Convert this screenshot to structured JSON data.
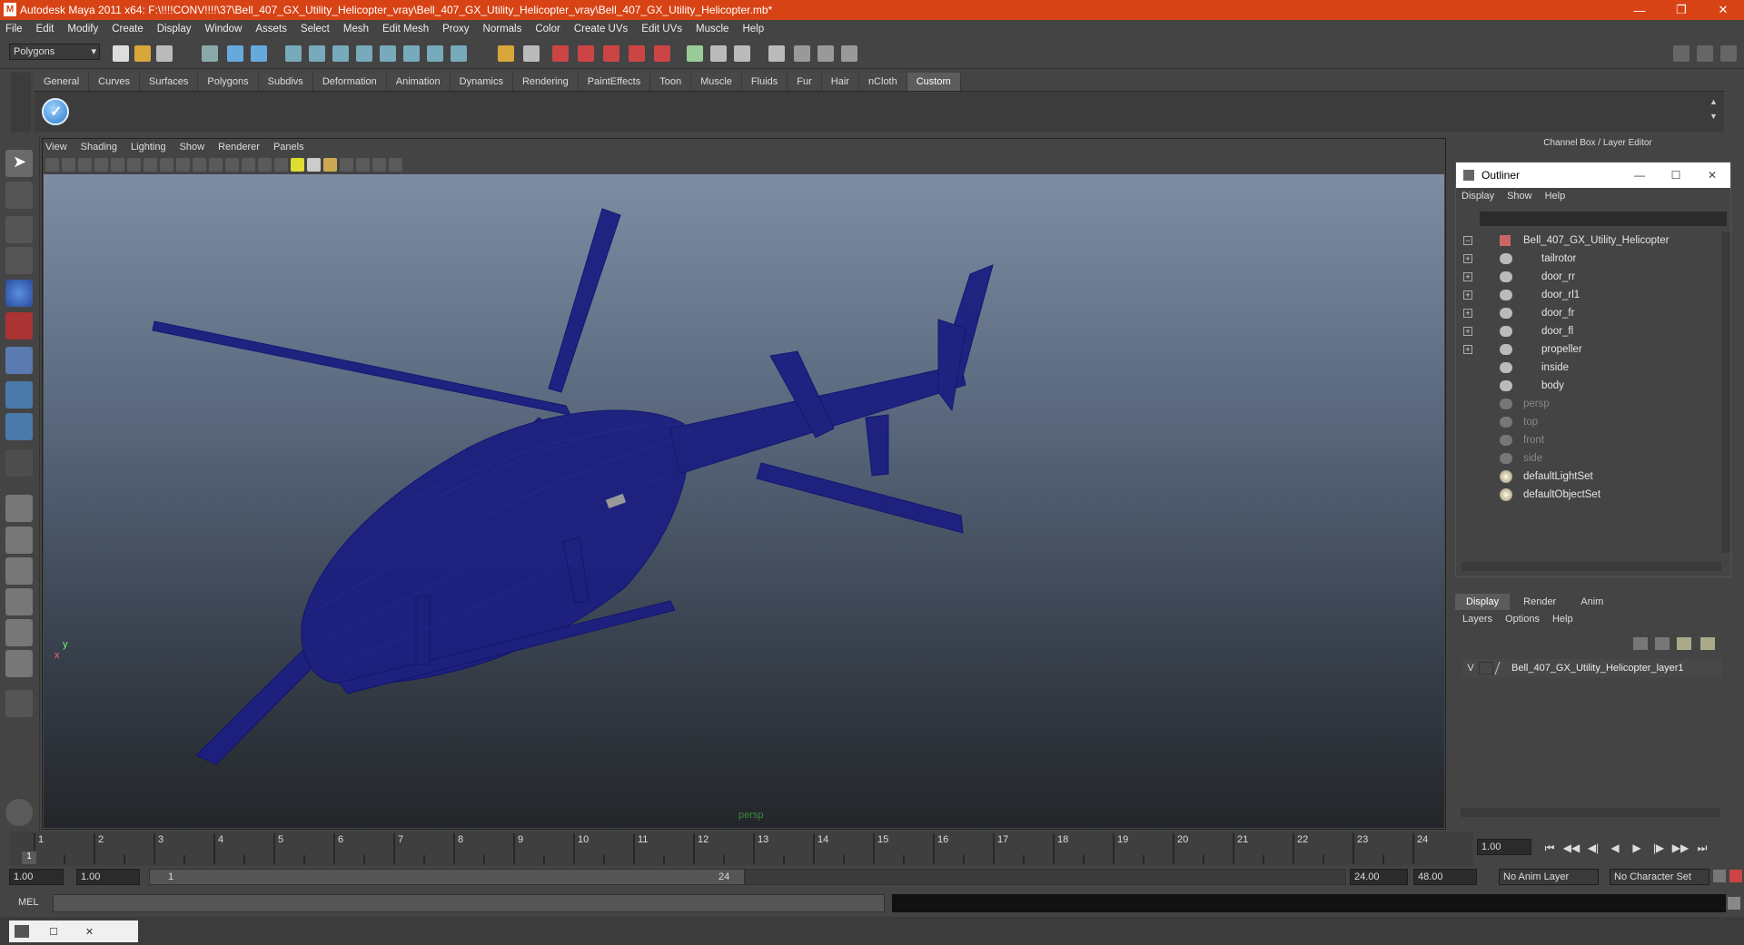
{
  "window": {
    "title": "Autodesk Maya 2011 x64: F:\\!!!!CONV!!!!\\37\\Bell_407_GX_Utility_Helicopter_vray\\Bell_407_GX_Utility_Helicopter_vray\\Bell_407_GX_Utility_Helicopter.mb*",
    "logo": "M"
  },
  "menubar": [
    "File",
    "Edit",
    "Modify",
    "Create",
    "Display",
    "Window",
    "Assets",
    "Select",
    "Mesh",
    "Edit Mesh",
    "Proxy",
    "Normals",
    "Color",
    "Create UVs",
    "Edit UVs",
    "Muscle",
    "Help"
  ],
  "statusline": {
    "mode": "Polygons"
  },
  "shelf_tabs": [
    "General",
    "Curves",
    "Surfaces",
    "Polygons",
    "Subdivs",
    "Deformation",
    "Animation",
    "Dynamics",
    "Rendering",
    "PaintEffects",
    "Toon",
    "Muscle",
    "Fluids",
    "Fur",
    "Hair",
    "nCloth",
    "Custom"
  ],
  "shelf_active": "Custom",
  "viewport": {
    "menu": [
      "View",
      "Shading",
      "Lighting",
      "Show",
      "Renderer",
      "Panels"
    ],
    "camera_label": "persp",
    "axis_y": "y",
    "axis_x": "x"
  },
  "channel_box": {
    "title": "Channel Box / Layer Editor"
  },
  "outliner": {
    "title": "Outliner",
    "menu": [
      "Display",
      "Show",
      "Help"
    ],
    "items": [
      {
        "label": "Bell_407_GX_Utility_Helicopter",
        "expand": "−"
      },
      {
        "label": "tailrotor",
        "expand": "+"
      },
      {
        "label": "door_rr",
        "expand": "+"
      },
      {
        "label": "door_rl1",
        "expand": "+"
      },
      {
        "label": "door_fr",
        "expand": "+"
      },
      {
        "label": "door_fl",
        "expand": "+"
      },
      {
        "label": "propeller",
        "expand": "+"
      },
      {
        "label": "inside",
        "expand": ""
      },
      {
        "label": "body",
        "expand": ""
      },
      {
        "label": "persp",
        "expand": ""
      },
      {
        "label": "top",
        "expand": ""
      },
      {
        "label": "front",
        "expand": ""
      },
      {
        "label": "side",
        "expand": ""
      },
      {
        "label": "defaultLightSet",
        "expand": ""
      },
      {
        "label": "defaultObjectSet",
        "expand": ""
      }
    ]
  },
  "layers": {
    "tabs": [
      "Display",
      "Render",
      "Anim"
    ],
    "menu": [
      "Layers",
      "Options",
      "Help"
    ],
    "visible_flag": "V",
    "layer_name": "Bell_407_GX_Utility_Helicopter_layer1"
  },
  "timeline": {
    "ticks": [
      "1",
      "2",
      "3",
      "4",
      "5",
      "6",
      "7",
      "8",
      "9",
      "10",
      "11",
      "12",
      "13",
      "14",
      "15",
      "16",
      "17",
      "18",
      "19",
      "20",
      "21",
      "22",
      "23",
      "24"
    ],
    "current_frame_box": "1",
    "current_time": "1.00"
  },
  "range": {
    "start": "1.00",
    "playback_start": "1.00",
    "slider_start": "1",
    "slider_end": "24",
    "playback_end": "24.00",
    "end": "48.00",
    "anim_layer": "No Anim Layer",
    "character_set": "No Character Set"
  },
  "cmdline": {
    "label": "MEL"
  }
}
